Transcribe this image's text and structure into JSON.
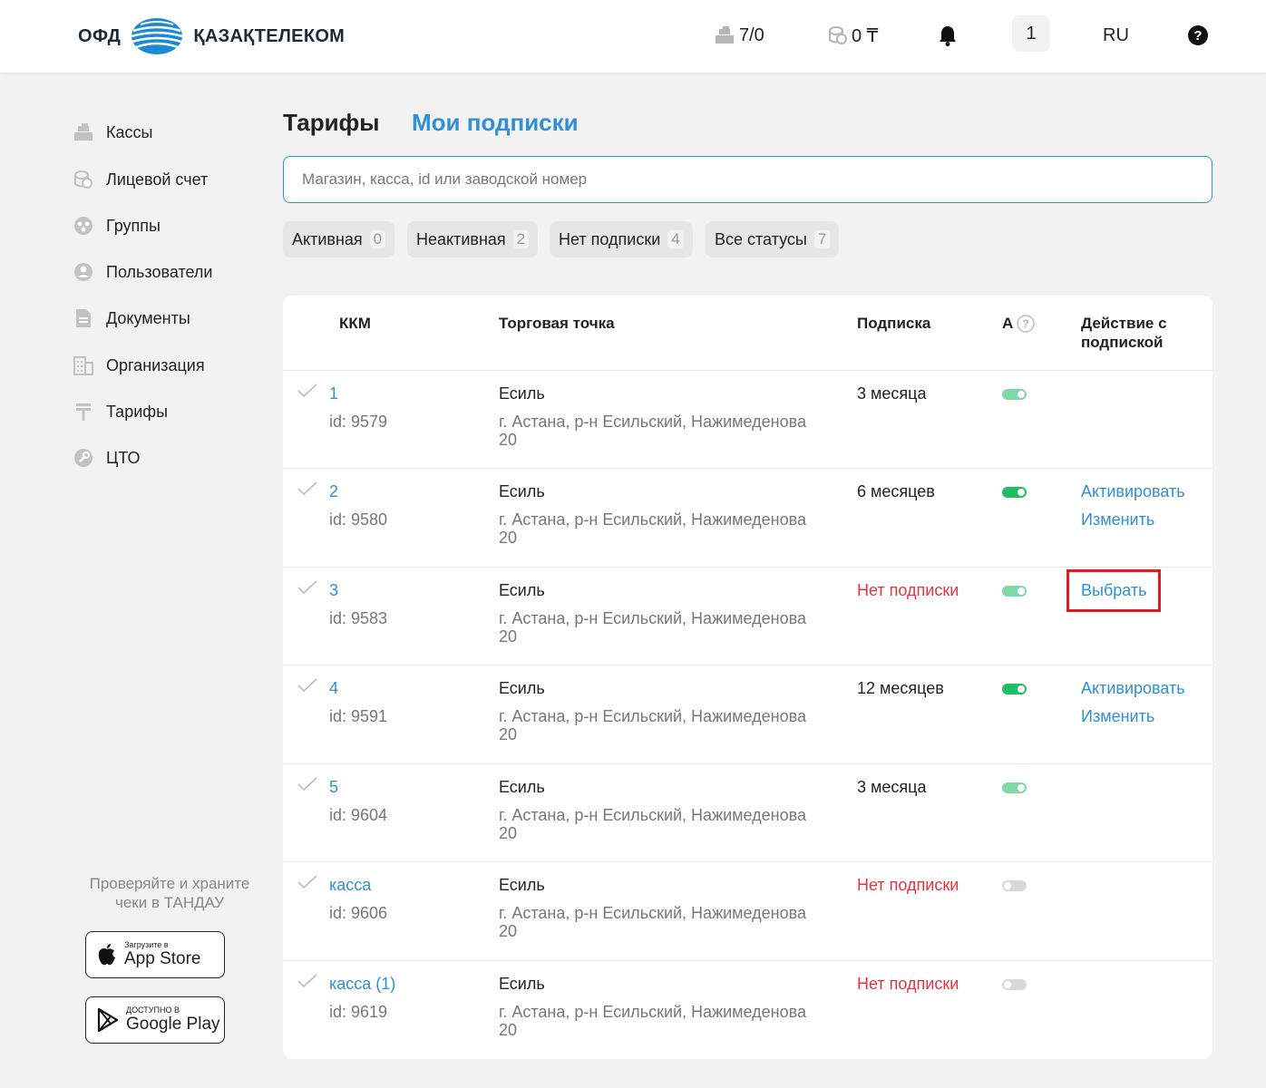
{
  "header": {
    "logo_left": "ОФД",
    "logo_right": "ҚАЗАҚТЕЛЕКОМ",
    "kkm_count": "7/0",
    "balance": "0 ₸",
    "user_badge": "1",
    "language": "RU"
  },
  "sidebar": {
    "items": [
      {
        "label": "Кассы",
        "icon": "cash-register-icon"
      },
      {
        "label": "Лицевой счет",
        "icon": "coins-icon"
      },
      {
        "label": "Группы",
        "icon": "groups-icon"
      },
      {
        "label": "Пользователи",
        "icon": "user-icon"
      },
      {
        "label": "Документы",
        "icon": "document-icon"
      },
      {
        "label": "Организация",
        "icon": "building-icon"
      },
      {
        "label": "Тарифы",
        "icon": "tenge-icon"
      },
      {
        "label": "ЦТО",
        "icon": "wrench-icon"
      }
    ],
    "promo": "Проверяйте и храните чеки в ТАНДАУ",
    "app_store": {
      "small": "Загрузите в",
      "big": "App Store"
    },
    "google_play": {
      "small": "ДОСТУПНО В",
      "big": "Google Play"
    }
  },
  "tabs": {
    "tariffs": "Тарифы",
    "my_subscriptions": "Мои подписки"
  },
  "search": {
    "placeholder": "Магазин, касса, id или заводской номер"
  },
  "filters": [
    {
      "label": "Активная",
      "count": "0"
    },
    {
      "label": "Неактивная",
      "count": "2"
    },
    {
      "label": "Нет подписки",
      "count": "4"
    },
    {
      "label": "Все статусы",
      "count": "7"
    }
  ],
  "table": {
    "headers": {
      "kkm": "ККМ",
      "shop": "Торговая точка",
      "subscription": "Подписка",
      "auto": "А",
      "action_line1": "Действие с",
      "action_line2": "подпиской"
    },
    "rows": [
      {
        "kkm": "1",
        "id": "id: 9579",
        "shop": "Есиль",
        "address": "г. Астана, р-н Есильский, Нажимеденова 20",
        "subscription": "3 месяца",
        "action1": "",
        "action2": ""
      },
      {
        "kkm": "2",
        "id": "id: 9580",
        "shop": "Есиль",
        "address": "г. Астана, р-н Есильский, Нажимеденова 20",
        "subscription": "6 месяцев",
        "action1": "Активировать",
        "action2": "Изменить"
      },
      {
        "kkm": "3",
        "id": "id: 9583",
        "shop": "Есиль",
        "address": "г. Астана, р-н Есильский, Нажимеденова 20",
        "subscription": "Нет подписки",
        "action1": "Выбрать",
        "action2": ""
      },
      {
        "kkm": "4",
        "id": "id: 9591",
        "shop": "Есиль",
        "address": "г. Астана, р-н Есильский, Нажимеденова 20",
        "subscription": "12 месяцев",
        "action1": "Активировать",
        "action2": "Изменить"
      },
      {
        "kkm": "5",
        "id": "id: 9604",
        "shop": "Есиль",
        "address": "г. Астана, р-н Есильский, Нажимеденова 20",
        "subscription": "3 месяца",
        "action1": "",
        "action2": ""
      },
      {
        "kkm": "касса",
        "id": "id: 9606",
        "shop": "Есиль",
        "address": "г. Астана, р-н Есильский, Нажимеденова 20",
        "subscription": "Нет подписки",
        "action1": "",
        "action2": ""
      },
      {
        "kkm": "касса (1)",
        "id": "id: 9619",
        "shop": "Есиль",
        "address": "г. Астана, р-н Есильский, Нажимеденова 20",
        "subscription": "Нет подписки",
        "action1": "",
        "action2": ""
      }
    ]
  },
  "colors": {
    "accent": "#2f8fd8",
    "danger": "#e5333f",
    "toggle_on": "#1dbf62",
    "toggle_light": "#7ed9a6"
  }
}
